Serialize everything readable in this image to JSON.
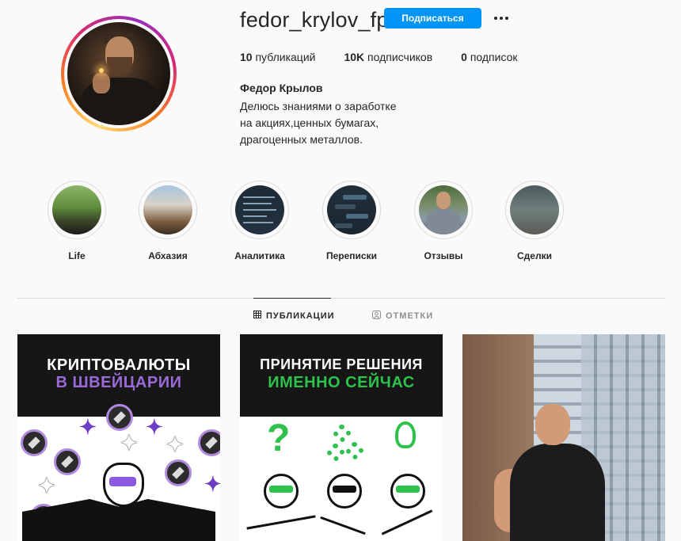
{
  "profile": {
    "username": "fedor_krylov_fp",
    "follow_label": "Подписаться",
    "stats": [
      {
        "value": "10",
        "label": "публикаций"
      },
      {
        "value": "10K",
        "label": "подписчиков"
      },
      {
        "value": "0",
        "label": "подписок"
      }
    ],
    "full_name": "Федор Крылов",
    "bio": [
      "Делюсь знаниями о заработке",
      "на акциях,ценных бумагах,",
      "драгоценных металлов."
    ]
  },
  "highlights": [
    {
      "label": "Life"
    },
    {
      "label": "Абхазия"
    },
    {
      "label": "Аналитика"
    },
    {
      "label": "Переписки"
    },
    {
      "label": "Отзывы"
    },
    {
      "label": "Сделки"
    }
  ],
  "tabs": [
    {
      "label": "ПУБЛИКАЦИИ",
      "icon": "grid-icon",
      "active": true
    },
    {
      "label": "ОТМЕТКИ",
      "icon": "tagged-icon",
      "active": false
    }
  ],
  "posts": [
    {
      "line1": "КРИПТОВАЛЮТЫ",
      "line2": "В ШВЕЙЦАРИИ"
    },
    {
      "line1": "ПРИНЯТИЕ РЕШЕНИЯ",
      "line2": "ИМЕННО СЕЙЧАС"
    },
    {}
  ],
  "colors": {
    "accent": "#0095f6",
    "text": "#262626",
    "muted": "#8e8e8e",
    "purple": "#9a6ad6",
    "green": "#2ec24c"
  }
}
